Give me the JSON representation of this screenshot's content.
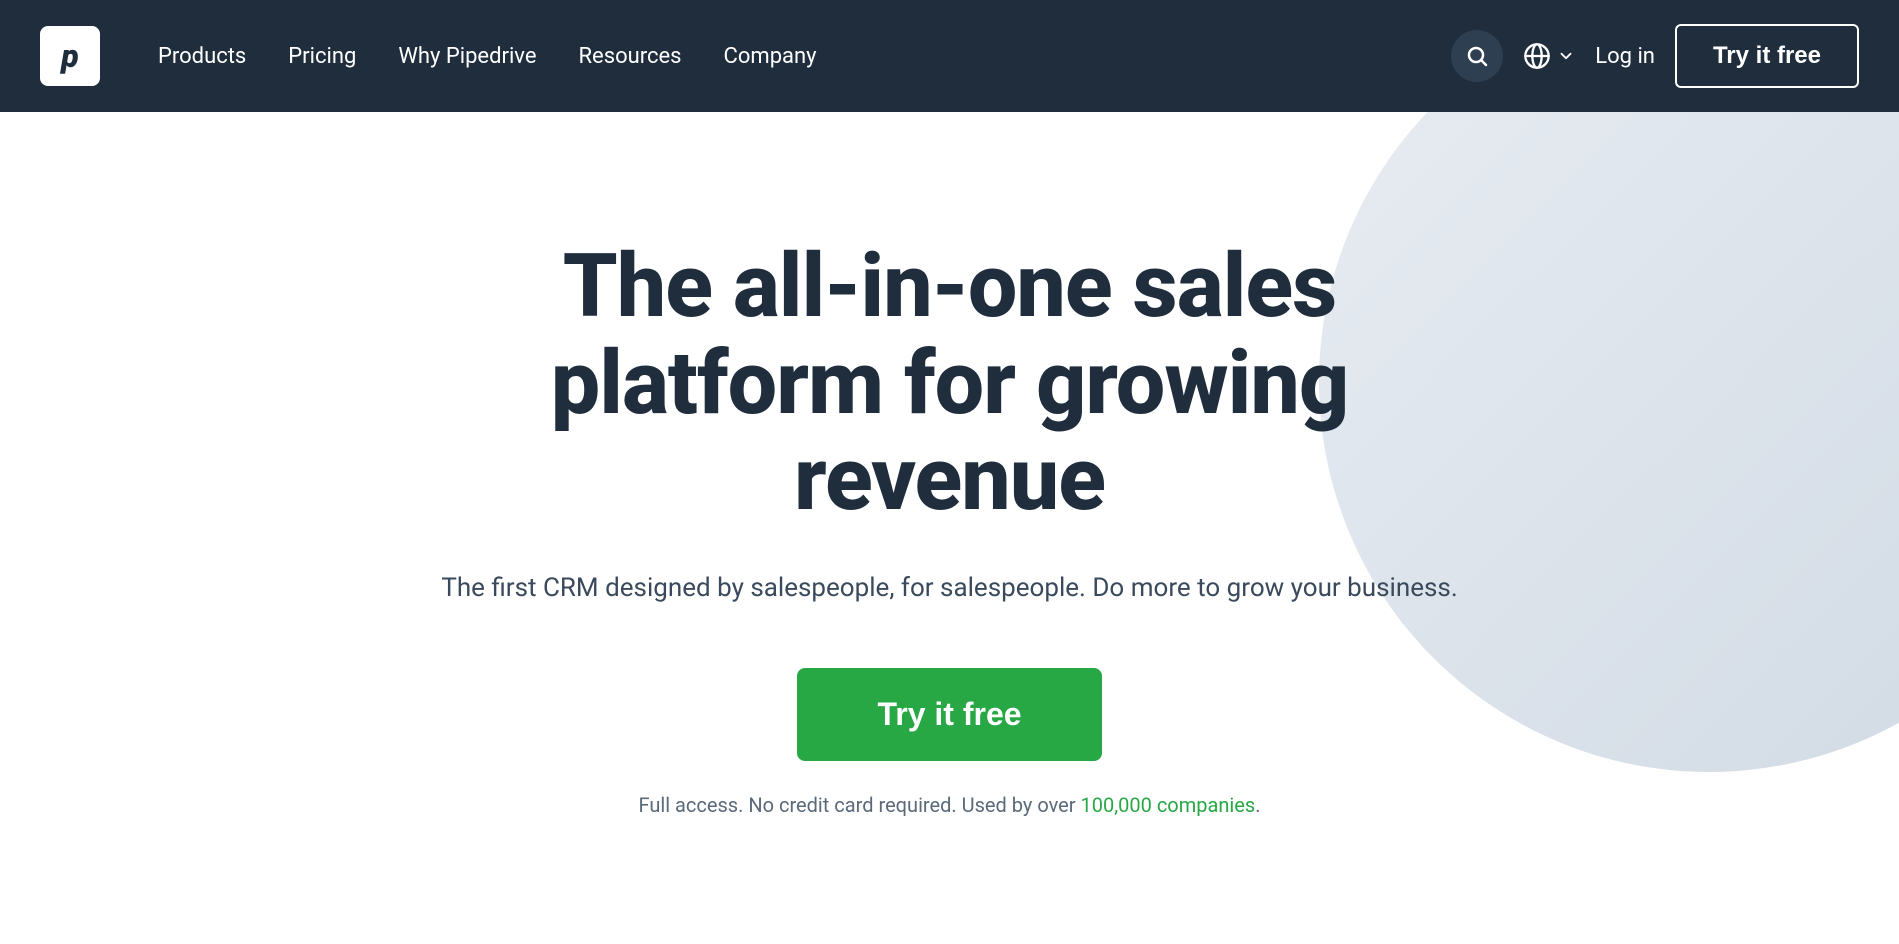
{
  "nav": {
    "logo_letter": "p",
    "links": [
      {
        "label": "Products",
        "id": "products"
      },
      {
        "label": "Pricing",
        "id": "pricing"
      },
      {
        "label": "Why Pipedrive",
        "id": "why-pipedrive"
      },
      {
        "label": "Resources",
        "id": "resources"
      },
      {
        "label": "Company",
        "id": "company"
      }
    ],
    "login_label": "Log in",
    "try_free_label": "Try it free",
    "lang_label": ""
  },
  "hero": {
    "title": "The all-in-one sales platform for growing revenue",
    "subtitle": "The first CRM designed by salespeople, for salespeople. Do more to grow your business.",
    "cta_label": "Try it free",
    "fine_print_before": "Full access. No credit card required. Used by over ",
    "fine_print_highlight": "100,000 companies",
    "fine_print_after": "."
  },
  "colors": {
    "nav_bg": "#1f2d3d",
    "hero_bg": "#ffffff",
    "title_color": "#1f2d3d",
    "cta_green": "#28a745",
    "nav_white": "#ffffff"
  }
}
